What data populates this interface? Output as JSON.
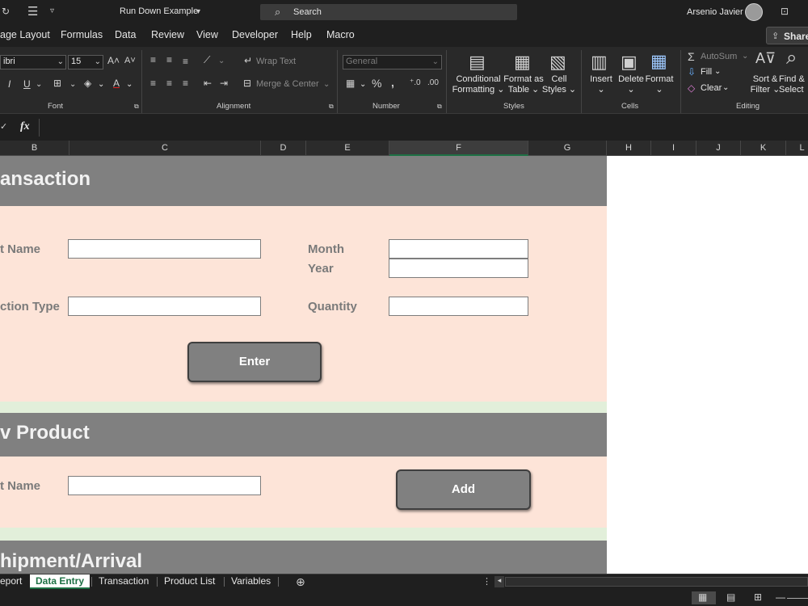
{
  "titlebar": {
    "doc_title": "Run Down Example",
    "search_placeholder": "Search",
    "user_name": "Arsenio Javier"
  },
  "ribbon_tabs": [
    "age Layout",
    "Formulas",
    "Data",
    "Review",
    "View",
    "Developer",
    "Help",
    "Macro"
  ],
  "share_label": "Share",
  "ribbon": {
    "font_name": "ibri",
    "font_size": "15",
    "font_group": "Font",
    "alignment_group": "Alignment",
    "wrap_text": "Wrap Text",
    "merge_center": "Merge & Center",
    "number_format": "General",
    "number_group": "Number",
    "conditional_formatting": [
      "Conditional",
      "Formatting"
    ],
    "format_as_table": [
      "Format as",
      "Table"
    ],
    "cell_styles": [
      "Cell",
      "Styles"
    ],
    "styles_group": "Styles",
    "insert": "Insert",
    "delete": "Delete",
    "format": "Format",
    "cells_group": "Cells",
    "autosum": "AutoSum",
    "fill": "Fill",
    "clear": "Clear",
    "sort_filter": [
      "Sort &",
      "Filter"
    ],
    "find_select": [
      "Find &",
      "Select"
    ],
    "editing_group": "Editing"
  },
  "formula_bar": {
    "fx": "fx"
  },
  "columns": [
    "B",
    "C",
    "D",
    "E",
    "F",
    "G",
    "H",
    "I",
    "J",
    "K",
    "L"
  ],
  "sections": {
    "transaction": {
      "title": "ansaction",
      "product_label": "t Name",
      "month_label": "Month",
      "year_label": "Year",
      "type_label": "ction Type",
      "quantity_label": "Quantity",
      "enter_button": "Enter"
    },
    "new_product": {
      "title": "v Product",
      "product_label": "t Name",
      "add_button": "Add"
    },
    "shipment": {
      "title": "hipment/Arrival"
    }
  },
  "sheet_tabs": [
    "eport",
    "Data Entry",
    "Transaction",
    "Product List",
    "Variables"
  ],
  "active_tab": "Data Entry",
  "colors": {
    "accent": "#1e7145",
    "section_header": "#808080",
    "section_body": "#fde4d8",
    "section_gap": "#e2efda"
  }
}
